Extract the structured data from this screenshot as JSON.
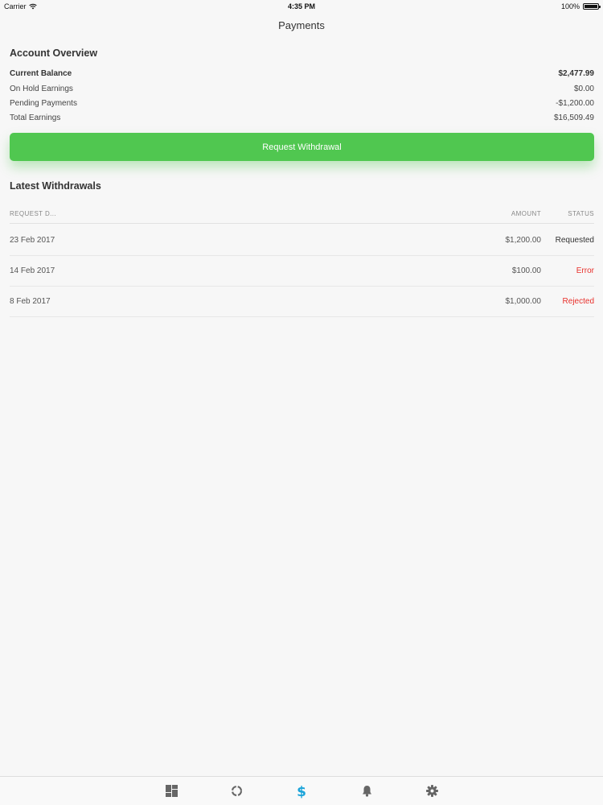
{
  "status_bar": {
    "carrier": "Carrier",
    "time": "4:35 PM",
    "battery": "100%"
  },
  "nav": {
    "title": "Payments"
  },
  "overview": {
    "title": "Account Overview",
    "rows": [
      {
        "label": "Current Balance",
        "value": "$2,477.99"
      },
      {
        "label": "On Hold Earnings",
        "value": "$0.00"
      },
      {
        "label": "Pending Payments",
        "value": "-$1,200.00"
      },
      {
        "label": "Total Earnings",
        "value": "$16,509.49"
      }
    ]
  },
  "withdraw_button": {
    "label": "Request Withdrawal"
  },
  "withdrawals": {
    "title": "Latest Withdrawals",
    "headers": {
      "date": "REQUEST D...",
      "amount": "AMOUNT",
      "status": "STATUS"
    },
    "rows": [
      {
        "date": "23 Feb 2017",
        "amount": "$1,200.00",
        "status": "Requested"
      },
      {
        "date": "14 Feb 2017",
        "amount": "$100.00",
        "status": "Error"
      },
      {
        "date": "8 Feb 2017",
        "amount": "$1,000.00",
        "status": "Rejected"
      }
    ]
  },
  "tabs": [
    {
      "icon": "dashboard-icon"
    },
    {
      "icon": "refresh-circle-icon"
    },
    {
      "icon": "dollar-icon",
      "active": true
    },
    {
      "icon": "bell-icon"
    },
    {
      "icon": "gear-icon"
    }
  ],
  "colors": {
    "accent": "#50c750",
    "active_tab": "#1aa3d9",
    "error": "#e8302b",
    "inactive_tab": "#666666"
  }
}
